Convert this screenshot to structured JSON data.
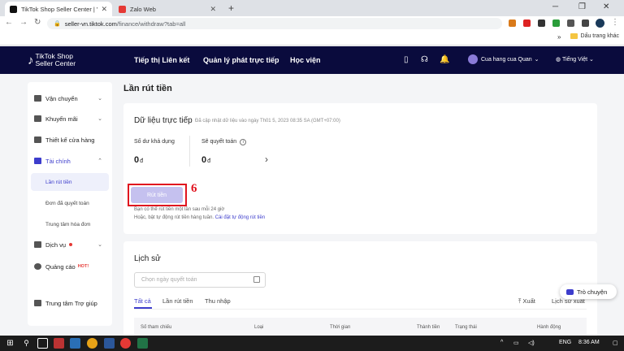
{
  "browser": {
    "tabs": [
      {
        "title": "TikTok Shop Seller Center | Vietn",
        "favicon_color": "#111111"
      },
      {
        "title": "Zalo Web",
        "favicon_color": "#e53935"
      }
    ],
    "url_host": "seller-vn.tiktok.com",
    "url_path": "/finance/withdraw?tab=all",
    "bookmark_folder": "Dấu trang khác",
    "bookmarks_chevron": "»"
  },
  "header": {
    "logo_line1": "TikTok Shop",
    "logo_line2": "Seller Center",
    "nav": [
      "Tiếp thị Liên kết",
      "Quản lý phát trực tiếp",
      "Học viện"
    ],
    "shop_name": "Cua hang cua Quan",
    "language": "Tiếng Việt",
    "bg_color": "#0a0b3d"
  },
  "sidebar": {
    "items": [
      {
        "label": "Vận chuyển"
      },
      {
        "label": "Khuyến mãi"
      },
      {
        "label": "Thiết kế cửa hàng"
      },
      {
        "label": "Tài chính"
      },
      {
        "label": "Dịch vụ"
      },
      {
        "label": "Quảng cáo",
        "badge": "HOT!"
      },
      {
        "label": "Trung tâm Trợ giúp"
      }
    ],
    "sub_items": [
      "Lần rút tiền",
      "Đơn đã quyết toán",
      "Trung tâm hóa đơn"
    ]
  },
  "main": {
    "page_title": "Lần rút tiền",
    "live_data": {
      "title": "Dữ liệu trực tiếp",
      "updated": "Đã cập nhật dữ liệu vào ngày Th01 5, 2023 08:35 SA (GMT+07:00)",
      "available_label": "Số dư khả dụng",
      "available_value": "0",
      "settlement_label": "Sẽ quyết toán",
      "settlement_value": "0",
      "currency": "đ",
      "withdraw_button": "Rút tiền",
      "annotation": "6",
      "note1": "Bạn có thể rút tiền một lần sau mỗi 24 giờ",
      "note2_prefix": "Hoặc, bật tự động rút tiền hàng tuần.",
      "note2_link": "Cài đặt tự động rút tiền"
    },
    "history": {
      "title": "Lịch sử",
      "date_placeholder": "Chọn ngày quyết toán",
      "tabs": [
        "Tất cả",
        "Lần rút tiền",
        "Thu nhập"
      ],
      "export": "Xuất",
      "export_history": "Lịch sử xuất",
      "columns": [
        "Số tham chiếu",
        "Loại",
        "Thời gian",
        "Thành tiền",
        "Trạng thái",
        "Hành động"
      ]
    },
    "chat_button": "Trò chuyện"
  },
  "taskbar": {
    "language": "ENG",
    "time": "8:36 AM"
  },
  "colors": {
    "accent": "#3d3dcc",
    "annotation_red": "#e0131f",
    "button_disabled": "#c5c1ef"
  }
}
